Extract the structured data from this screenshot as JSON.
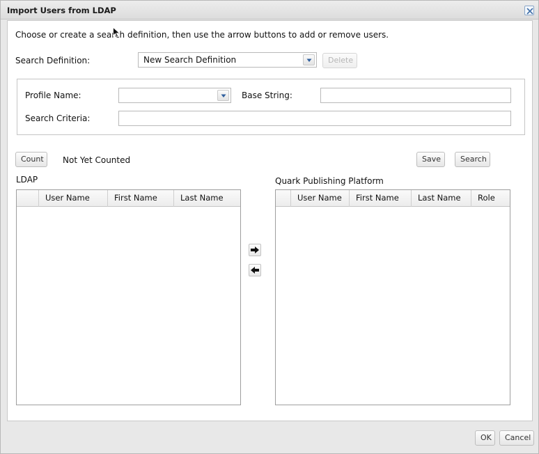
{
  "dialog": {
    "title": "Import Users from LDAP",
    "close_icon": "close-icon"
  },
  "intro": {
    "text": "Choose or create a search definition, then use the arrow buttons to add or remove users."
  },
  "search_definition": {
    "label": "Search Definition:",
    "selected": "New Search Definition",
    "delete_label": "Delete",
    "delete_enabled": false
  },
  "profile": {
    "profile_name_label": "Profile Name:",
    "profile_name_value": "",
    "base_string_label": "Base String:",
    "base_string_value": "",
    "search_criteria_label": "Search Criteria:",
    "search_criteria_value": ""
  },
  "count": {
    "button_label": "Count",
    "status": "Not Yet Counted"
  },
  "actions": {
    "save_label": "Save",
    "search_label": "Search"
  },
  "ldap_panel": {
    "title": "LDAP",
    "columns": [
      "",
      "User Name",
      "First Name",
      "Last Name"
    ],
    "rows": []
  },
  "qpp_panel": {
    "title": "Quark Publishing Platform",
    "columns": [
      "",
      "User Name",
      "First Name",
      "Last Name",
      "Role"
    ],
    "rows": []
  },
  "transfer": {
    "add_icon": "arrow-right-icon",
    "remove_icon": "arrow-left-icon"
  },
  "footer": {
    "ok_label": "OK",
    "cancel_label": "Cancel"
  }
}
